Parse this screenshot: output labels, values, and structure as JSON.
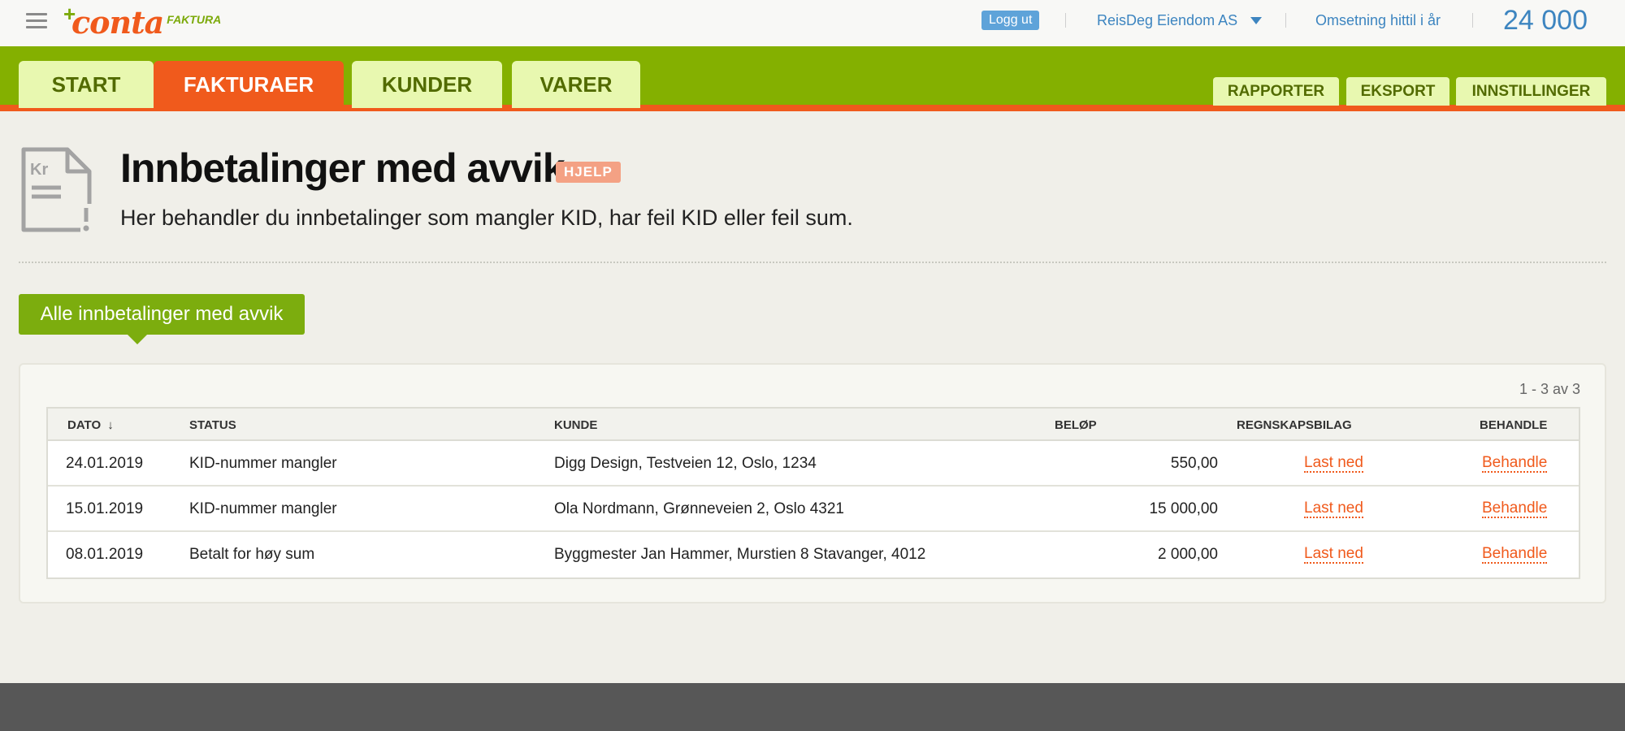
{
  "header": {
    "logo": {
      "brand": "conta",
      "sub": "FAKTURA"
    },
    "logout_label": "Logg ut",
    "company_name": "ReisDeg Eiendom AS",
    "revenue_label": "Omsetning hittil i år",
    "revenue_value": "24 000"
  },
  "nav": {
    "tabs": [
      {
        "label": "START",
        "active": false
      },
      {
        "label": "FAKTURAER",
        "active": true
      },
      {
        "label": "KUNDER",
        "active": false
      },
      {
        "label": "VARER",
        "active": false
      }
    ],
    "right_tabs": [
      {
        "label": "RAPPORTER"
      },
      {
        "label": "EKSPORT"
      },
      {
        "label": "INNSTILLINGER"
      }
    ]
  },
  "page": {
    "icon_text": "Kr",
    "title": "Innbetalinger med avvik",
    "help_label": "HJELP",
    "subtitle": "Her behandler du innbetalinger som mangler KID, har feil KID eller feil sum.",
    "filter_label": "Alle innbetalinger med avvik"
  },
  "table": {
    "pager": "1 - 3  av  3",
    "columns": {
      "date": "DATO",
      "sort_icon": "↓",
      "status": "STATUS",
      "customer": "KUNDE",
      "amount": "BELØP",
      "voucher": "REGNSKAPSBILAG",
      "action": "BEHANDLE"
    },
    "rows": [
      {
        "date": "24.01.2019",
        "status": "KID-nummer mangler",
        "customer": "Digg Design, Testveien 12, Oslo, 1234",
        "amount": "550,00",
        "voucher": "Last ned",
        "action": "Behandle"
      },
      {
        "date": "15.01.2019",
        "status": "KID-nummer mangler",
        "customer": "Ola Nordmann, Grønneveien 2, Oslo 4321",
        "amount": "15 000,00",
        "voucher": "Last ned",
        "action": "Behandle"
      },
      {
        "date": "08.01.2019",
        "status": "Betalt for høy sum",
        "customer": "Byggmester Jan Hammer, Murstien 8 Stavanger, 4012",
        "amount": "2 000,00",
        "voucher": "Last ned",
        "action": "Behandle"
      }
    ]
  },
  "colors": {
    "brand_orange": "#f05a1c",
    "brand_green": "#84b000",
    "link_blue": "#3d85c0"
  }
}
